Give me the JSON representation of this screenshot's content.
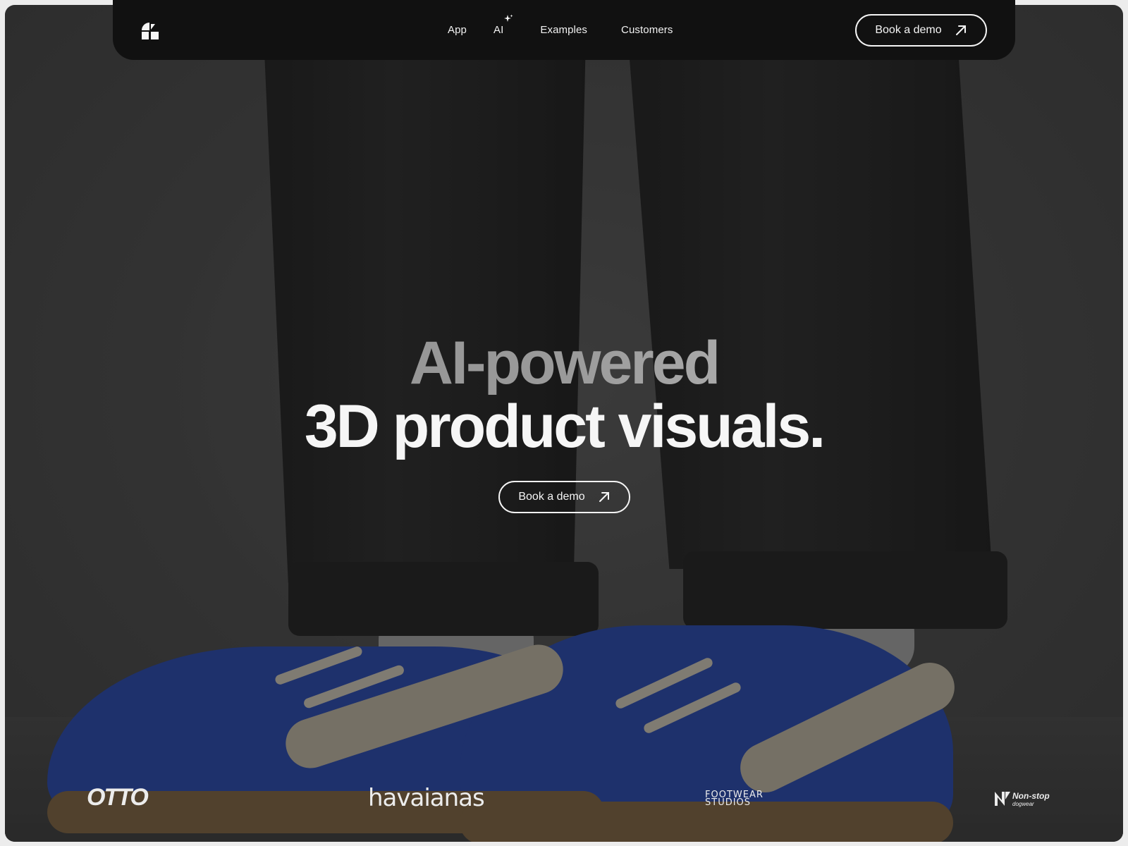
{
  "nav": {
    "links": [
      "App",
      "AI",
      "Examples",
      "Customers"
    ],
    "cta_label": "Book a demo"
  },
  "hero": {
    "line1": "AI-powered",
    "line2": "3D product visuals.",
    "cta_label": "Book a demo"
  },
  "brands": {
    "otto": "OTTO",
    "havaianas": "havaianas",
    "footwear_line1": "FOOTWEAR",
    "footwear_line2": "STUDIOS",
    "nonstop": "Non-stop",
    "nonstop_sub": "dogwear"
  },
  "icons": {
    "logo": "brand-logo-icon",
    "ai_sparkle": "sparkle-icon",
    "cta_arrow": "arrow-up-right-icon"
  },
  "colors": {
    "nav_bg": "#111111",
    "text": "#f5f5f5",
    "shoe_blue": "#1c3a99"
  }
}
